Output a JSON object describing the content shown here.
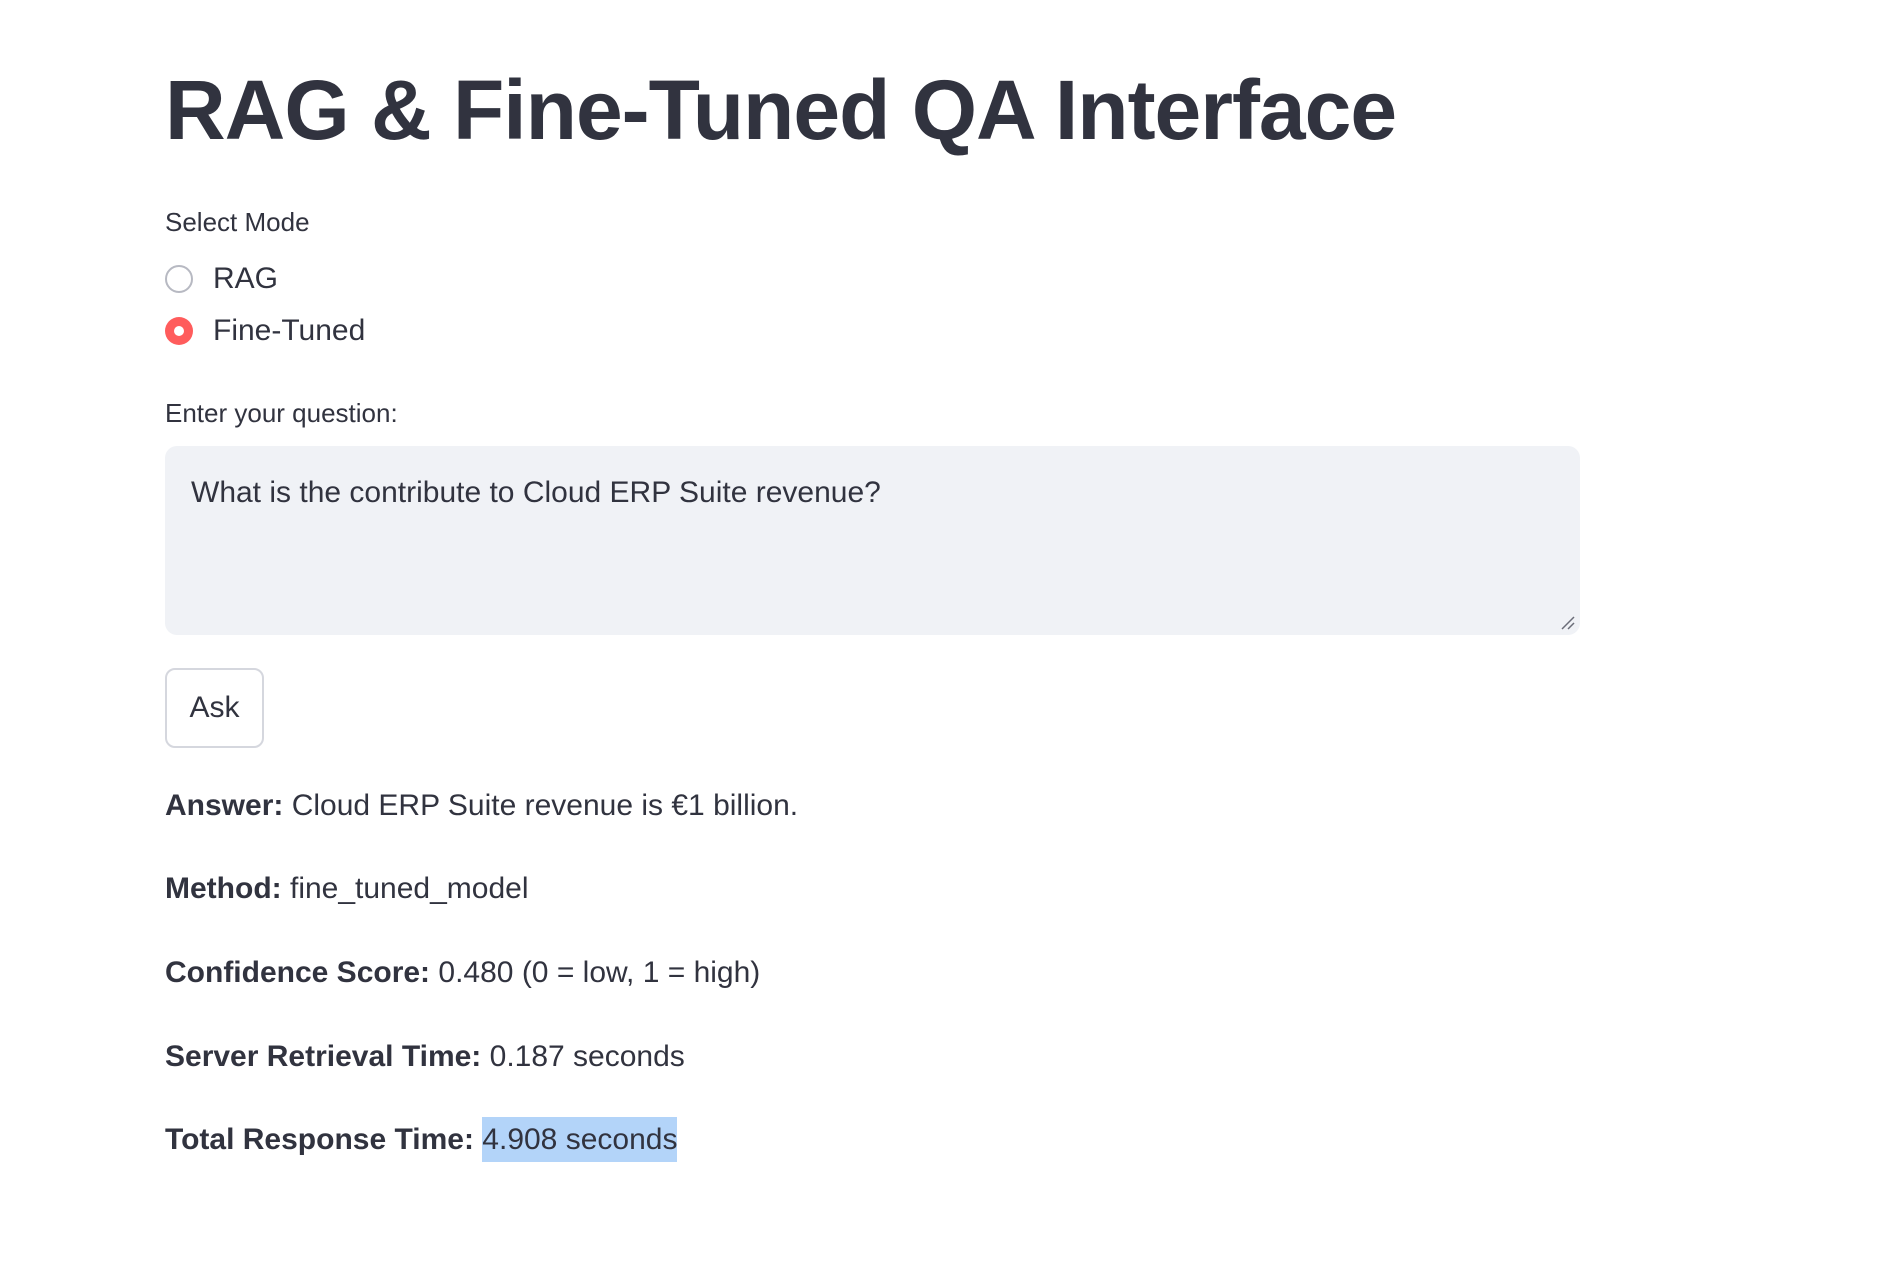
{
  "header": {
    "title": "RAG & Fine-Tuned QA Interface"
  },
  "mode": {
    "label": "Select Mode",
    "options": [
      {
        "label": "RAG",
        "selected": false
      },
      {
        "label": "Fine-Tuned",
        "selected": true
      }
    ],
    "accent_color": "#ff4b4b"
  },
  "question": {
    "label": "Enter your question:",
    "value": "What is the contribute to Cloud ERP Suite revenue?"
  },
  "ask_button": {
    "label": "Ask"
  },
  "results": {
    "answer": {
      "label": "Answer:",
      "value": "Cloud ERP Suite revenue is €1 billion."
    },
    "method": {
      "label": "Method:",
      "value": "fine_tuned_model"
    },
    "confidence": {
      "label": "Confidence Score:",
      "value": "0.480 (0 = low, 1 = high)"
    },
    "server_time": {
      "label": "Server Retrieval Time:",
      "value": "0.187 seconds"
    },
    "total_time": {
      "label": "Total Response Time:",
      "value": "4.908 seconds",
      "highlighted": true
    }
  }
}
